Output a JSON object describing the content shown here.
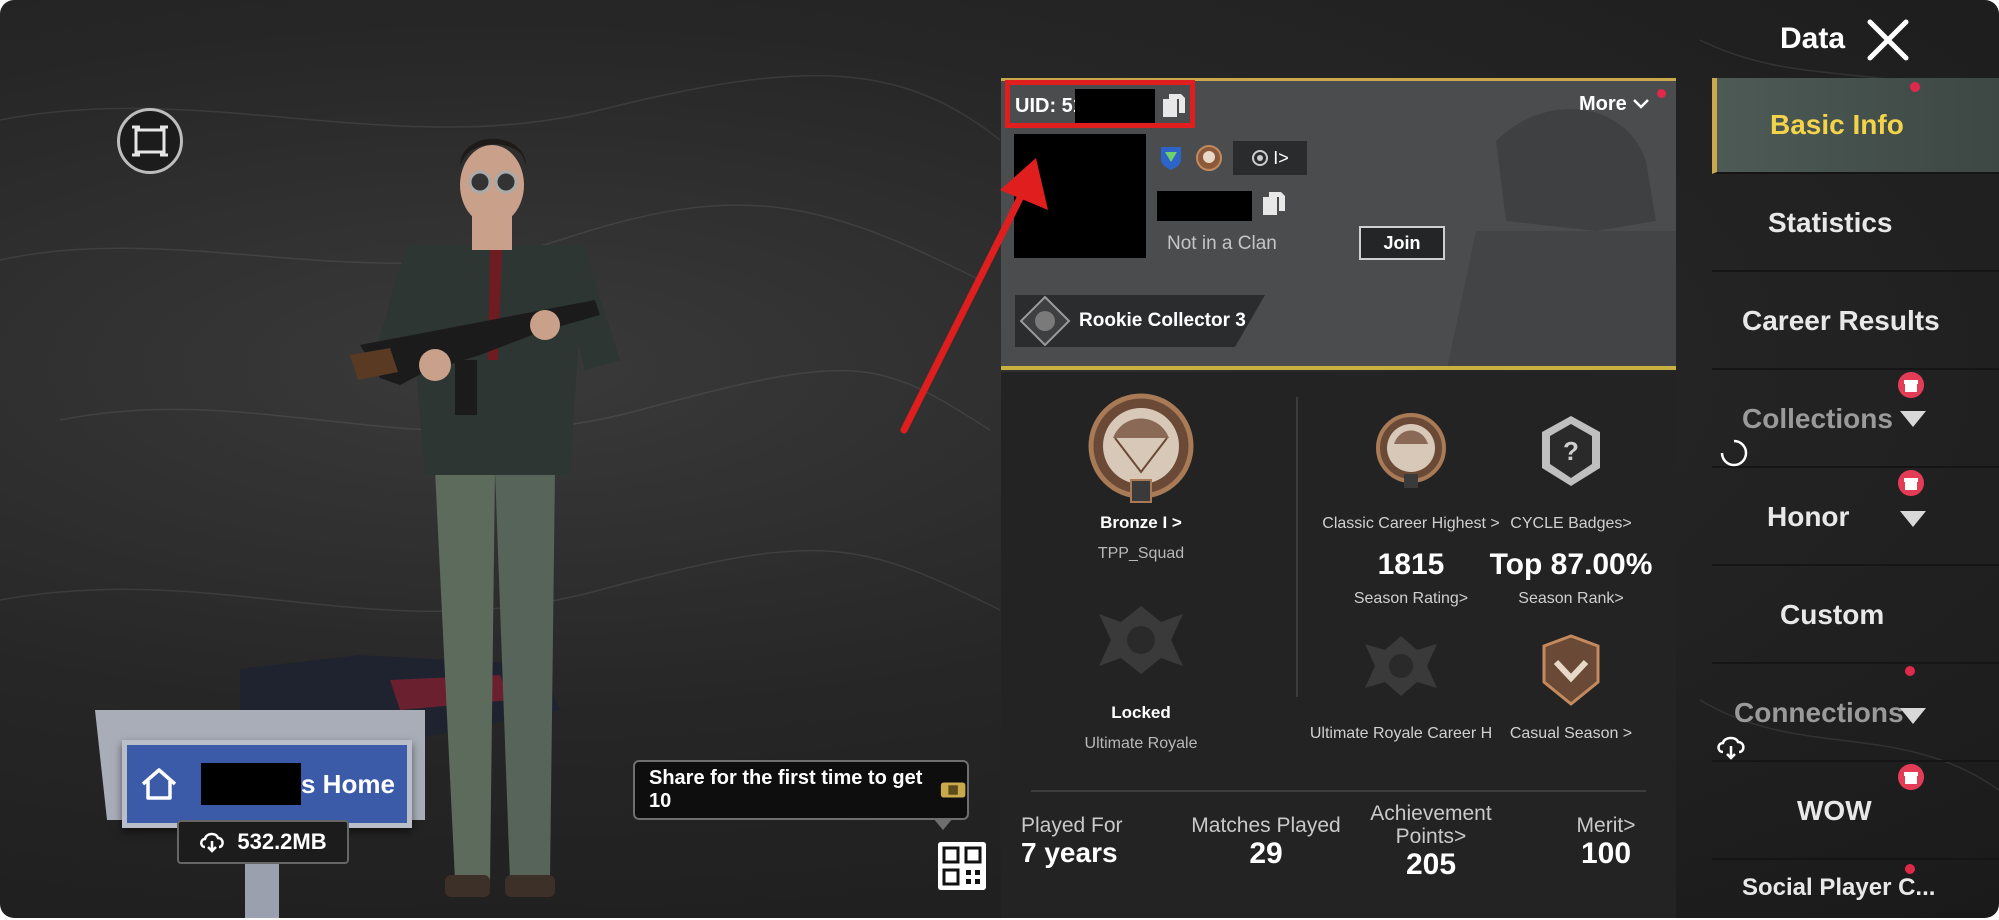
{
  "header": {
    "title": "Data"
  },
  "left": {
    "home_suffix": "s Home",
    "download_size": "532.2MB",
    "share_tooltip": "Share for the first time to get 10"
  },
  "profile": {
    "uid_label": "UID: 512",
    "more_label": "More",
    "rank_chip": "I>",
    "clan_status": "Not in a Clan",
    "join_label": "Join",
    "title_name": "Rookie Collector 3"
  },
  "stats": {
    "main_tier": {
      "label": "Bronze I >",
      "mode": "TPP_Squad"
    },
    "classic_highest": "Classic Career Highest >",
    "cycle_badges": "CYCLE Badges>",
    "season_rating": {
      "value": "1815",
      "label": "Season Rating>"
    },
    "season_rank": {
      "value": "Top 87.00%",
      "label": "Season Rank>"
    },
    "ultimate": {
      "status": "Locked",
      "label": "Ultimate Royale"
    },
    "ultimate_career": "Ultimate Royale Career H",
    "casual_season": "Casual Season >",
    "played_for": {
      "label": "Played For",
      "value": "7 years"
    },
    "matches_played": {
      "label": "Matches Played",
      "value": "29"
    },
    "achievement_points": {
      "label_line1": "Achievement",
      "label_line2": "Points>",
      "value": "205"
    },
    "merit": {
      "label": "Merit>",
      "value": "100"
    }
  },
  "sidebar": {
    "items": [
      {
        "label": "Basic Info",
        "active": true
      },
      {
        "label": "Statistics"
      },
      {
        "label": "Career Results"
      },
      {
        "label": "Collections"
      },
      {
        "label": "Honor"
      },
      {
        "label": "Custom"
      },
      {
        "label": "Connections"
      },
      {
        "label": "WOW"
      },
      {
        "label": "Social Player C..."
      }
    ]
  },
  "colors": {
    "accent_gold": "#c9a94b",
    "active_text": "#f3d34a",
    "notify_red": "#e0294a",
    "annotation_red": "#e01e1e"
  }
}
